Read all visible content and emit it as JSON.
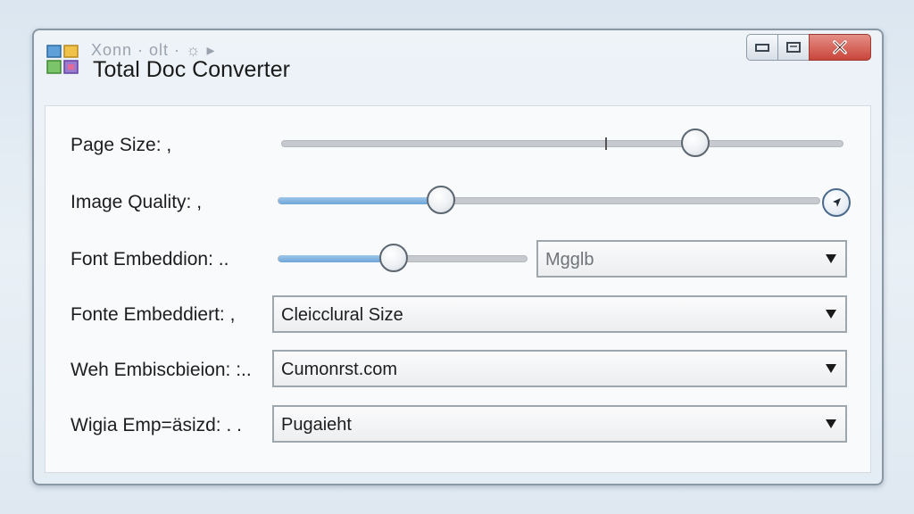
{
  "window": {
    "ghost_title": "Xonn · olt · ☼ ▸",
    "title": "Total Doc Converter"
  },
  "caption_buttons": {
    "minimize": "minimize",
    "maximize": "maximize",
    "close": "close"
  },
  "rows": [
    {
      "label": "Page Size: ,",
      "control": "slider",
      "value": 0.735
    },
    {
      "label": "Image Quality: ,",
      "control": "slider",
      "value": 0.3
    },
    {
      "label": "Font Embeddion: ..",
      "control": "slider+dropdown",
      "value": 0.46,
      "dropdown_value": "Mgglb"
    },
    {
      "label": "Fonte Embeddiert: ,",
      "control": "dropdown",
      "dropdown_value": "Cleicclural Size"
    },
    {
      "label": "Weh Embiscbieion: :..",
      "control": "dropdown",
      "dropdown_value": "Cumonrst.com"
    },
    {
      "label": "Wigia Emp=äsizd: . .",
      "control": "dropdown",
      "dropdown_value": "Pugaieht"
    }
  ],
  "icons": {
    "app": "app-logo-icon",
    "minimize": "minimize-icon",
    "maximize": "maximize-icon",
    "close": "close-icon",
    "dropdown": "chevron-down-icon",
    "end_knob": "cursor-arrow-icon"
  },
  "colors": {
    "accent": "#6ea6d8",
    "close": "#c9453a"
  }
}
